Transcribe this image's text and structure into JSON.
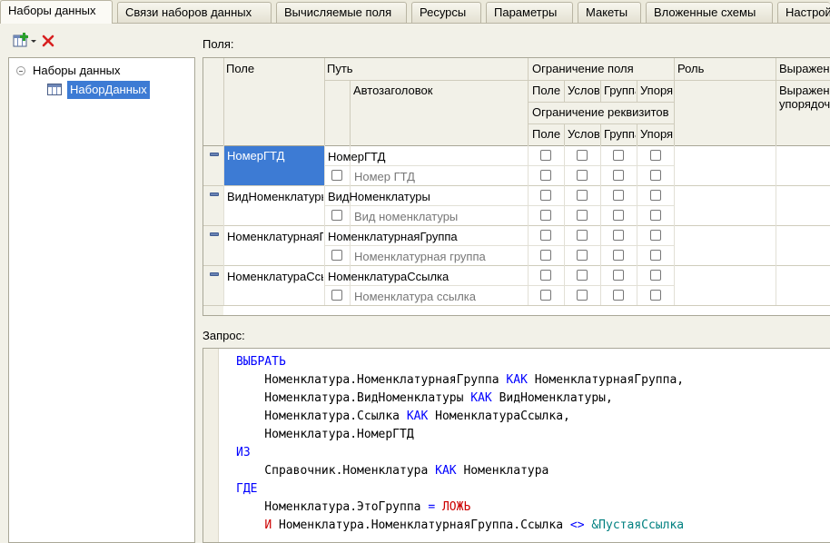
{
  "tabs": [
    {
      "label": "Наборы данных",
      "active": true
    },
    {
      "label": "Связи наборов данных"
    },
    {
      "label": "Вычисляемые поля"
    },
    {
      "label": "Ресурсы"
    },
    {
      "label": "Параметры"
    },
    {
      "label": "Макеты"
    },
    {
      "label": "Вложенные схемы"
    },
    {
      "label": "Настройки"
    }
  ],
  "tree": {
    "root": "Наборы данных",
    "child": "НаборДанных"
  },
  "fields_label": "Поля:",
  "query_label": "Запрос:",
  "grid": {
    "headers": {
      "field": "Поле",
      "path": "Путь",
      "autotitle": "Автозаголовок",
      "field_restriction": "Ограничение поля",
      "attr_restriction": "Ограничение реквизитов",
      "role": "Роль",
      "expression": "Выражение",
      "expression_order": "Выражение упорядочивания",
      "sub": [
        "Поле",
        "Условие",
        "Группа",
        "Упорядочивание"
      ]
    },
    "rows": [
      {
        "field": "НомерГТД",
        "path": "НомерГТД",
        "title": "Номер ГТД",
        "selected": true
      },
      {
        "field": "ВидНоменклатуры",
        "path": "ВидНоменклатуры",
        "title": "Вид номенклатуры"
      },
      {
        "field": "НоменклатурнаяГруппа",
        "path": "НоменклатурнаяГруппа",
        "title": "Номенклатурная группа"
      },
      {
        "field": "НоменклатураСсылка",
        "path": "НоменклатураСсылка",
        "title": "Номенклатура ссылка"
      }
    ]
  },
  "query": {
    "lines": [
      [
        {
          "t": "ВЫБРАТЬ",
          "k": "kw"
        }
      ],
      [
        {
          "t": "    Номенклатура.НоменклатурнаяГруппа ",
          "k": "id"
        },
        {
          "t": "КАК",
          "k": "kw"
        },
        {
          "t": " НоменклатурнаяГруппа,",
          "k": "id"
        }
      ],
      [
        {
          "t": "    Номенклатура.ВидНоменклатуры ",
          "k": "id"
        },
        {
          "t": "КАК",
          "k": "kw"
        },
        {
          "t": " ВидНоменклатуры,",
          "k": "id"
        }
      ],
      [
        {
          "t": "    Номенклатура.Ссылка ",
          "k": "id"
        },
        {
          "t": "КАК",
          "k": "kw"
        },
        {
          "t": " НоменклатураСсылка,",
          "k": "id"
        }
      ],
      [
        {
          "t": "    Номенклатура.НомерГТД",
          "k": "id"
        }
      ],
      [
        {
          "t": "ИЗ",
          "k": "kw"
        }
      ],
      [
        {
          "t": "    Справочник.Номенклатура ",
          "k": "id"
        },
        {
          "t": "КАК",
          "k": "kw"
        },
        {
          "t": " Номенклатура",
          "k": "id"
        }
      ],
      [
        {
          "t": "ГДЕ",
          "k": "kw"
        }
      ],
      [
        {
          "t": "    Номенклатура.ЭтоГруппа ",
          "k": "id"
        },
        {
          "t": "=",
          "k": "kw"
        },
        {
          "t": " ",
          "k": "id"
        },
        {
          "t": "ЛОЖЬ",
          "k": "op"
        }
      ],
      [
        {
          "t": "    ",
          "k": "id"
        },
        {
          "t": "И",
          "k": "op"
        },
        {
          "t": " Номенклатура.НоменклатурнаяГруппа.Ссылка ",
          "k": "id"
        },
        {
          "t": "<>",
          "k": "kw"
        },
        {
          "t": " ",
          "k": "id"
        },
        {
          "t": "&ПустаяСсылка",
          "k": "prm"
        }
      ]
    ]
  }
}
